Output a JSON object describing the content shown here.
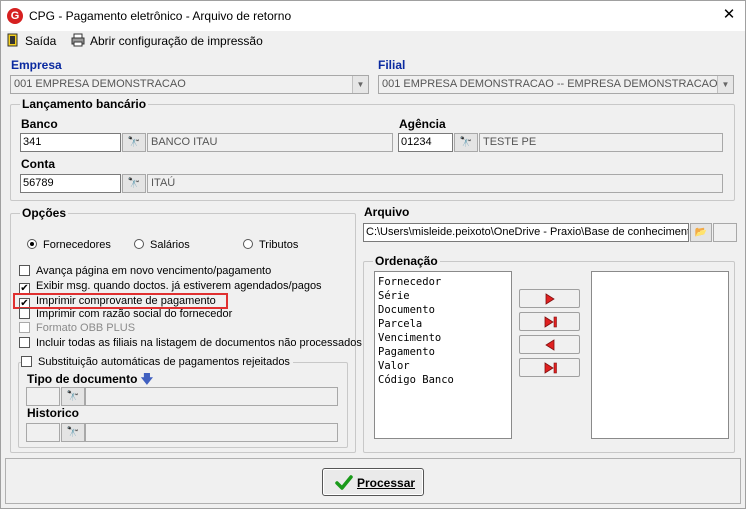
{
  "window": {
    "title": "CPG - Pagamento eletrônico - Arquivo de retorno",
    "app_icon": "G",
    "close": "✕"
  },
  "menu": {
    "exit_label": "Saída",
    "print_config_label": "Abrir configuração de impressão"
  },
  "empresa": {
    "label": "Empresa",
    "value": "001 EMPRESA DEMONSTRACAO"
  },
  "filial": {
    "label": "Filial",
    "value": "001 EMPRESA DEMONSTRACAO -- EMPRESA DEMONSTRACAO"
  },
  "lancamento": {
    "group_label": "Lançamento bancário",
    "banco_label": "Banco",
    "banco_code": "341",
    "banco_name": "BANCO ITAU",
    "agencia_label": "Agência",
    "agencia_code": "01234",
    "agencia_name": "TESTE PE",
    "conta_label": "Conta",
    "conta_code": "56789",
    "conta_name": "ITAÚ"
  },
  "opcoes": {
    "group_label": "Opções",
    "radios": [
      "Fornecedores",
      "Salários",
      "Tributos"
    ],
    "selected_radio": "Fornecedores",
    "checks": [
      {
        "label": "Avança página em novo vencimento/pagamento",
        "checked": false,
        "disabled": false
      },
      {
        "label": "Exibir msg. quando doctos. já estiverem agendados/pagos",
        "checked": true,
        "disabled": false
      },
      {
        "label": "Imprimir comprovante de pagamento",
        "checked": true,
        "disabled": false
      },
      {
        "label": "Imprimir com razão social do fornecedor",
        "checked": false,
        "disabled": false
      },
      {
        "label": "Formato OBB PLUS",
        "checked": false,
        "disabled": true
      },
      {
        "label": "Incluir todas as filiais na listagem de documentos não processados",
        "checked": false,
        "disabled": false
      }
    ],
    "substituicao_label": "Substituição automáticas de pagamentos rejeitados",
    "tipo_documento_label": "Tipo de documento",
    "historico_label": "Historico"
  },
  "arquivo": {
    "label": "Arquivo",
    "path": "C:\\Users\\misleide.peixoto\\OneDrive - Praxio\\Base de conhecimento"
  },
  "ordenacao": {
    "group_label": "Ordenação",
    "items": [
      "Fornecedor",
      "Série",
      "Documento",
      "Parcela",
      "Vencimento",
      "Pagamento",
      "Valor",
      "Código Banco"
    ]
  },
  "footer": {
    "process_label": "Processar"
  },
  "colors": {
    "label_blue": "#0a2aa0",
    "arrow_red": "#e02020",
    "highlight_red": "#e03030",
    "check_green": "#1a9a1a"
  }
}
